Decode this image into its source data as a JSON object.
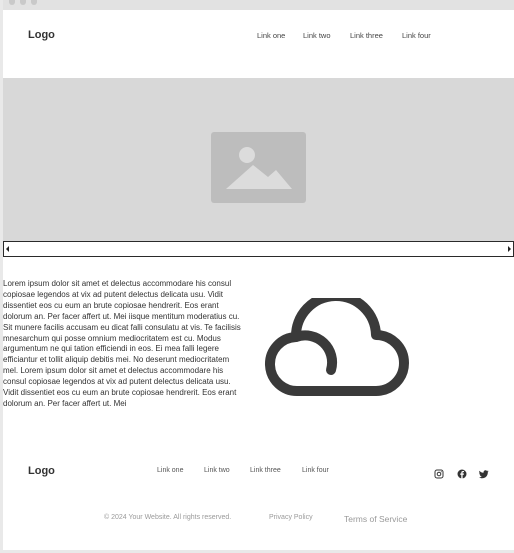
{
  "header": {
    "logo": "Logo",
    "nav": [
      "Link one",
      "Link two",
      "Link three",
      "Link four"
    ]
  },
  "hero": {
    "image_icon": "image-placeholder-icon"
  },
  "content": {
    "paragraph": "Lorem ipsum dolor sit amet et delectus accommodare his consul copiosae legendos at vix ad putent delectus delicata usu. Vidit dissentiet eos cu eum an brute copiosae hendrerit. Eos erant dolorum an. Per facer affert ut. Mei iisque mentitum moderatius cu. Sit munere facilis accusam eu dicat falli consulatu at vis. Te facilisis mnesarchum qui posse omnium mediocritatem est cu. Modus argumentum ne qui tation efficiendi in eos. Ei mea falli legere efficiantur et tollit aliquip debitis mei. No deserunt mediocritatem mel. Lorem ipsum dolor sit amet et delectus accommodare his consul copiosae legendos at vix ad putent delectus delicata usu. Vidit dissentiet eos cu eum an brute copiosae hendrerit. Eos erant dolorum an. Per facer affert ut. Mei",
    "illustration_icon": "cloud-icon"
  },
  "footer": {
    "logo": "Logo",
    "nav": [
      "Link one",
      "Link two",
      "Link three",
      "Link four"
    ],
    "social_icons": [
      "instagram-icon",
      "facebook-icon",
      "twitter-icon"
    ],
    "copyright": "© 2024 Your Website. All rights reserved.",
    "privacy": "Privacy Policy",
    "terms": "Terms of Service"
  }
}
